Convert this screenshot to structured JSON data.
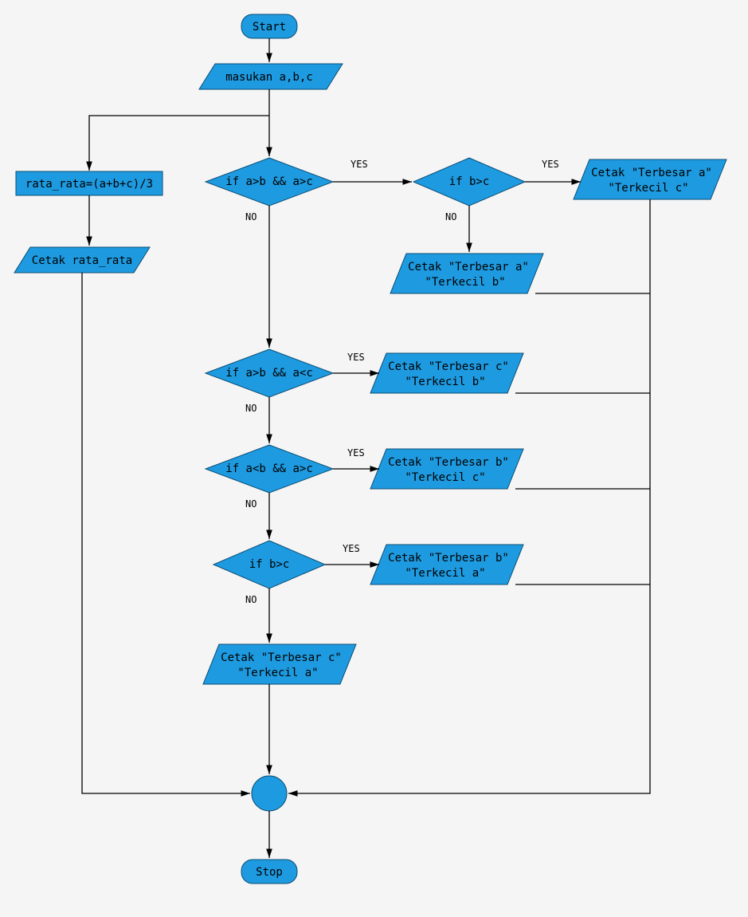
{
  "flowchart": {
    "start": "Start",
    "input": "masukan a,b,c",
    "process_avg": "rata_rata=(a+b+c)/3",
    "print_avg": "Cetak rata_rata",
    "dec1": "if a>b && a>c",
    "dec1_yes": "YES",
    "dec1_no": "NO",
    "dec1b": "if b>c",
    "dec1b_yes": "YES",
    "dec1b_no": "NO",
    "out1b_yes_l1": "Cetak \"Terbesar a\"",
    "out1b_yes_l2": "\"Terkecil c\"",
    "out1b_no_l1": "Cetak \"Terbesar a\"",
    "out1b_no_l2": "\"Terkecil b\"",
    "dec2": "if a>b && a<c",
    "dec2_yes": "YES",
    "dec2_no": "NO",
    "out2_l1": "Cetak \"Terbesar c\"",
    "out2_l2": "\"Terkecil b\"",
    "dec3": "if a<b && a>c",
    "dec3_yes": "YES",
    "dec3_no": "NO",
    "out3_l1": "Cetak \"Terbesar b\"",
    "out3_l2": "\"Terkecil c\"",
    "dec4": "if b>c",
    "dec4_yes": "YES",
    "dec4_no": "NO",
    "out4_l1": "Cetak \"Terbesar b\"",
    "out4_l2": "\"Terkecil a\"",
    "out_last_l1": "Cetak \"Terbesar c\"",
    "out_last_l2": "\"Terkecil a\"",
    "stop": "Stop"
  },
  "colors": {
    "node_fill": "#1e9ae0",
    "node_stroke": "#0a4d74",
    "edge": "#000000",
    "bg": "#f5f5f5"
  }
}
